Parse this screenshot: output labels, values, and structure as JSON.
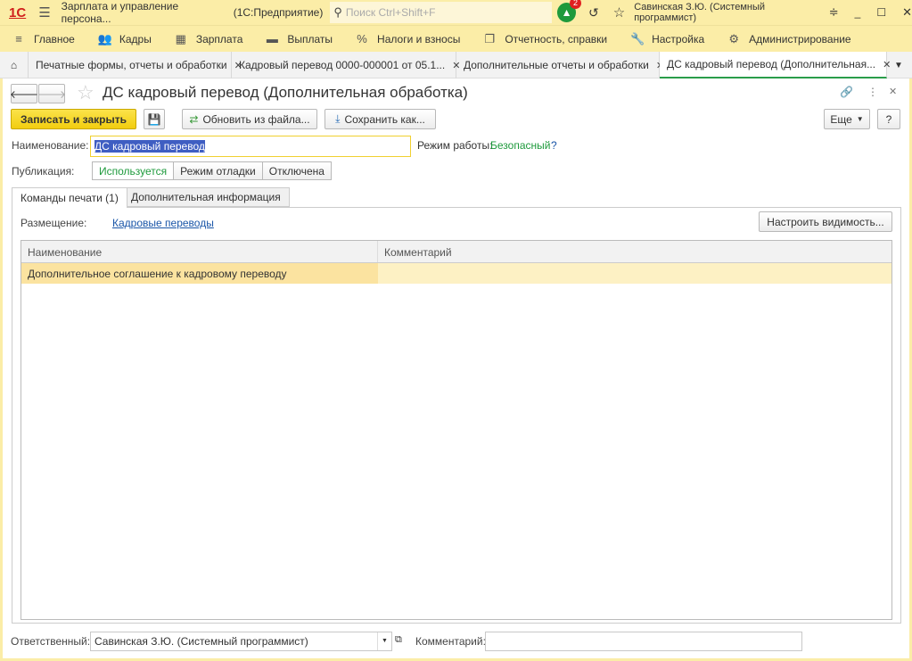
{
  "titlebar": {
    "logo": "1С",
    "app_title": "Зарплата и управление персона...",
    "platform": "(1С:Предприятие)",
    "search_placeholder": "Поиск Ctrl+Shift+F",
    "notifications_count": "2",
    "user": "Савинская З.Ю. (Системный программист)"
  },
  "sections": [
    {
      "icon": "menu-icon",
      "label": "Главное"
    },
    {
      "icon": "people-icon",
      "label": "Кадры"
    },
    {
      "icon": "calculator-icon",
      "label": "Зарплата"
    },
    {
      "icon": "wallet-icon",
      "label": "Выплаты"
    },
    {
      "icon": "percent-icon",
      "label": "Налоги и взносы"
    },
    {
      "icon": "documents-icon",
      "label": "Отчетность, справки"
    },
    {
      "icon": "wrench-icon",
      "label": "Настройка"
    },
    {
      "icon": "gear-icon",
      "label": "Администрирование"
    }
  ],
  "tabs": [
    {
      "label": "Печатные формы, отчеты и обработки"
    },
    {
      "label": "Кадровый перевод 0000-000001 от 05.1..."
    },
    {
      "label": "Дополнительные отчеты и обработки"
    },
    {
      "label": "ДС кадровый перевод (Дополнительная..."
    }
  ],
  "form": {
    "title": "ДС кадровый перевод (Дополнительная обработка)",
    "save_close": "Записать и закрыть",
    "update_from_file": "Обновить из файла...",
    "save_as": "Сохранить как...",
    "more": "Еще",
    "help": "?",
    "name_label": "Наименование:",
    "name_value": "ДС кадровый перевод",
    "mode_label": "Режим работы:",
    "mode_value": "Безопасный",
    "mode_help": "?",
    "publication_label": "Публикация:",
    "publication_options": [
      "Используется",
      "Режим отладки",
      "Отключена"
    ],
    "inner_tabs": [
      "Команды печати (1)",
      "Дополнительная информация"
    ],
    "placement_label": "Размещение:",
    "placement_value": "Кадровые переводы",
    "configure_visibility": "Настроить видимость...",
    "table": {
      "columns": [
        "Наименование",
        "Комментарий"
      ],
      "rows": [
        [
          "Дополнительное соглашение к кадровому переводу",
          ""
        ]
      ]
    },
    "responsible_label": "Ответственный:",
    "responsible_value": "Савинская З.Ю. (Системный программист)",
    "comment_label": "Комментарий:",
    "comment_value": ""
  },
  "colors": {
    "accent_green": "#1e9a3c",
    "primary_yellow": "#f5d713",
    "selection": "#fce9a2"
  }
}
